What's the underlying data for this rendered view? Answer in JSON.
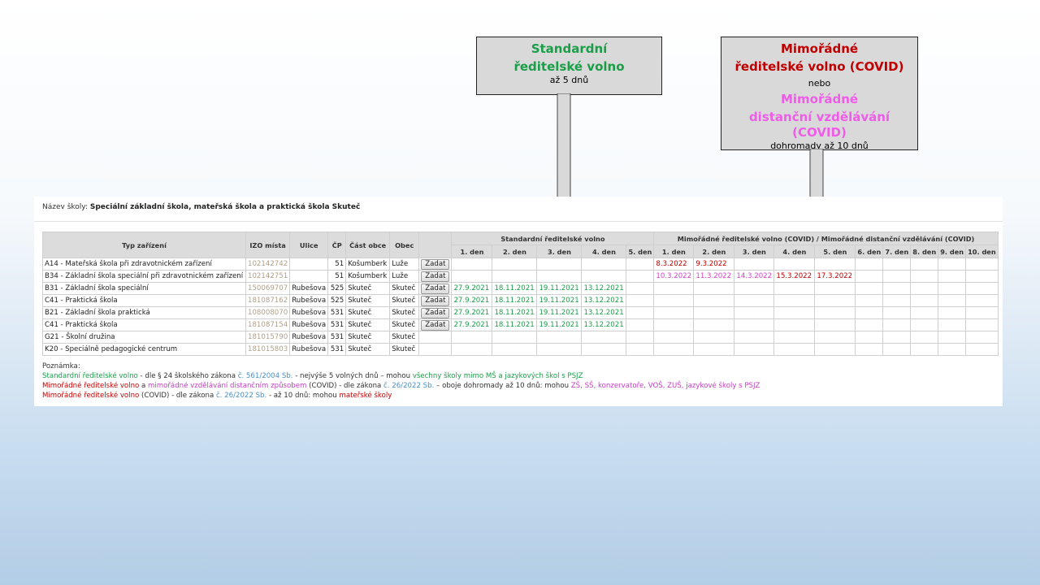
{
  "callouts": {
    "standard": {
      "line1": "Standardní",
      "line2": "ředitelské volno",
      "line3": "až 5 dnů"
    },
    "covid": {
      "line1": "Mimořádné",
      "line2": "ředitelské volno (COVID)",
      "or": "nebo",
      "line3": "Mimořádné",
      "line4": "distanční vzdělávání (COVID)",
      "line5": "dohromady až 10 dnů"
    }
  },
  "school": {
    "label": "Název školy:",
    "name": "Speciální základní škola, mateřská škola a praktická škola Skuteč"
  },
  "table": {
    "headers": {
      "type": "Typ zařízení",
      "izo": "IZO místa",
      "street": "Ulice",
      "cp": "ČP",
      "part": "Část obce",
      "town": "Obec",
      "standard_group": "Standardní ředitelské volno",
      "covid_group": "Mimořádné ředitelské volno (COVID) / Mimořádné distanční vzdělávání (COVID)"
    },
    "std_days": [
      "1. den",
      "2. den",
      "3. den",
      "4. den",
      "5. den"
    ],
    "covid_days": [
      "1. den",
      "2. den",
      "3. den",
      "4. den",
      "5. den",
      "6. den",
      "7. den",
      "8. den",
      "9. den",
      "10. den"
    ],
    "rows": [
      {
        "type": "A14 - Mateřská škola při zdravotnickém zařízení",
        "izo": "102142742",
        "street": "",
        "cp": "51",
        "part": "Košumberk",
        "town": "Luže",
        "btn": "Zadat",
        "std": [
          "",
          "",
          "",
          "",
          ""
        ],
        "covid": [
          "8.3.2022",
          "9.3.2022",
          "",
          "",
          "",
          "",
          "",
          "",
          "",
          ""
        ],
        "covid_colors": [
          "red",
          "red",
          "",
          "",
          "",
          "",
          "",
          "",
          "",
          ""
        ]
      },
      {
        "type": "B34 - Základní škola speciální při zdravotnickém zařízení",
        "izo": "102142751",
        "street": "",
        "cp": "51",
        "part": "Košumberk",
        "town": "Luže",
        "btn": "Zadat",
        "std": [
          "",
          "",
          "",
          "",
          ""
        ],
        "covid": [
          "10.3.2022",
          "11.3.2022",
          "14.3.2022",
          "15.3.2022",
          "17.3.2022",
          "",
          "",
          "",
          "",
          ""
        ],
        "covid_colors": [
          "pink",
          "pink",
          "pink",
          "red",
          "red",
          "",
          "",
          "",
          "",
          ""
        ]
      },
      {
        "type": "B31 - Základní škola speciální",
        "izo": "150069707",
        "street": "Rubešova",
        "cp": "525",
        "part": "Skuteč",
        "town": "Skuteč",
        "btn": "Zadat",
        "std": [
          "27.9.2021",
          "18.11.2021",
          "19.11.2021",
          "13.12.2021",
          ""
        ],
        "covid": [
          "",
          "",
          "",
          "",
          "",
          "",
          "",
          "",
          "",
          ""
        ],
        "covid_colors": [
          "",
          "",
          "",
          "",
          "",
          "",
          "",
          "",
          "",
          ""
        ]
      },
      {
        "type": "C41 - Praktická škola",
        "izo": "181087162",
        "street": "Rubešova",
        "cp": "525",
        "part": "Skuteč",
        "town": "Skuteč",
        "btn": "Zadat",
        "std": [
          "27.9.2021",
          "18.11.2021",
          "19.11.2021",
          "13.12.2021",
          ""
        ],
        "covid": [
          "",
          "",
          "",
          "",
          "",
          "",
          "",
          "",
          "",
          ""
        ],
        "covid_colors": [
          "",
          "",
          "",
          "",
          "",
          "",
          "",
          "",
          "",
          ""
        ]
      },
      {
        "type": "B21 - Základní škola praktická",
        "izo": "108008070",
        "street": "Rubešova",
        "cp": "531",
        "part": "Skuteč",
        "town": "Skuteč",
        "btn": "Zadat",
        "std": [
          "27.9.2021",
          "18.11.2021",
          "19.11.2021",
          "13.12.2021",
          ""
        ],
        "covid": [
          "",
          "",
          "",
          "",
          "",
          "",
          "",
          "",
          "",
          ""
        ],
        "covid_colors": [
          "",
          "",
          "",
          "",
          "",
          "",
          "",
          "",
          "",
          ""
        ]
      },
      {
        "type": "C41 - Praktická škola",
        "izo": "181087154",
        "street": "Rubešova",
        "cp": "531",
        "part": "Skuteč",
        "town": "Skuteč",
        "btn": "Zadat",
        "std": [
          "27.9.2021",
          "18.11.2021",
          "19.11.2021",
          "13.12.2021",
          ""
        ],
        "covid": [
          "",
          "",
          "",
          "",
          "",
          "",
          "",
          "",
          "",
          ""
        ],
        "covid_colors": [
          "",
          "",
          "",
          "",
          "",
          "",
          "",
          "",
          "",
          ""
        ]
      },
      {
        "type": "G21 - Školní družina",
        "izo": "181015790",
        "street": "Rubešova",
        "cp": "531",
        "part": "Skuteč",
        "town": "Skuteč",
        "btn": "",
        "std": [
          "",
          "",
          "",
          "",
          ""
        ],
        "covid": [
          "",
          "",
          "",
          "",
          "",
          "",
          "",
          "",
          "",
          ""
        ],
        "covid_colors": [
          "",
          "",
          "",
          "",
          "",
          "",
          "",
          "",
          "",
          ""
        ]
      },
      {
        "type": "K20 - Speciálně pedagogické centrum",
        "izo": "181015803",
        "street": "Rubešova",
        "cp": "531",
        "part": "Skuteč",
        "town": "Skuteč",
        "btn": "",
        "std": [
          "",
          "",
          "",
          "",
          ""
        ],
        "covid": [
          "",
          "",
          "",
          "",
          "",
          "",
          "",
          "",
          "",
          ""
        ],
        "covid_colors": [
          "",
          "",
          "",
          "",
          "",
          "",
          "",
          "",
          "",
          ""
        ]
      }
    ]
  },
  "notes": {
    "title": "Poznámka:",
    "l1_a": "Standardní ředitelské volno",
    "l1_b": " - dle § 24 školského zákona ",
    "l1_c": "č. 561/2004 Sb.",
    "l1_d": " - nejvýše 5 volných dnů – mohou ",
    "l1_e": "všechny školy mimo MŠ a jazykových škol s PSJZ",
    "l2_a": "Mimořádné ředitelské volno",
    "l2_b": " a ",
    "l2_c": "mimořádné vzdělávání distančním způsobem",
    "l2_d": " (COVID) - dle zákona ",
    "l2_e": "č. 26/2022 Sb.",
    "l2_f": " – oboje dohromady až 10 dnů: mohou ",
    "l2_g": "ZŠ, SŠ, konzervatoře, VOŠ, ZUŠ, jazykové školy s PSJZ",
    "l3_a": "Mimořádné ředitelské volno",
    "l3_b": " (COVID) - dle zákona ",
    "l3_c": "č. 26/2022 Sb.",
    "l3_d": " - až 10 dnů: mohou ",
    "l3_e": "mateřské školy"
  }
}
